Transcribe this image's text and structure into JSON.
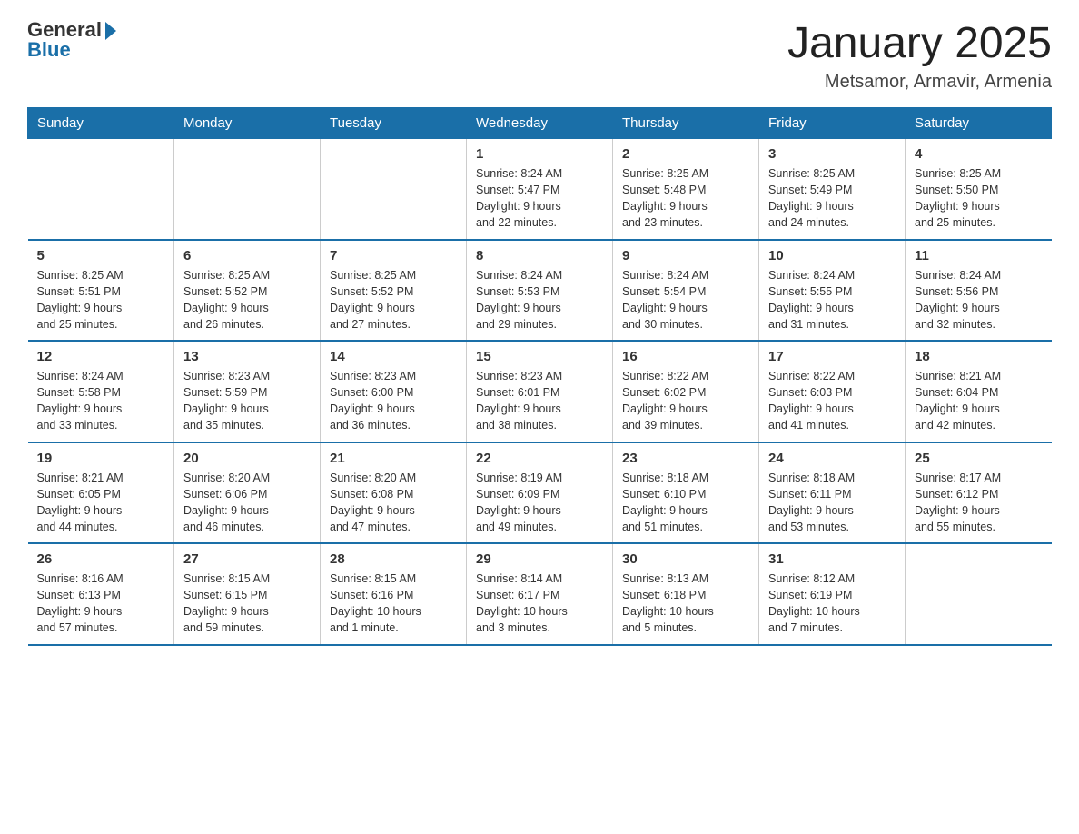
{
  "header": {
    "logo_general": "General",
    "logo_blue": "Blue",
    "title": "January 2025",
    "subtitle": "Metsamor, Armavir, Armenia"
  },
  "weekdays": [
    "Sunday",
    "Monday",
    "Tuesday",
    "Wednesday",
    "Thursday",
    "Friday",
    "Saturday"
  ],
  "weeks": [
    [
      {
        "day": "",
        "info": ""
      },
      {
        "day": "",
        "info": ""
      },
      {
        "day": "",
        "info": ""
      },
      {
        "day": "1",
        "info": "Sunrise: 8:24 AM\nSunset: 5:47 PM\nDaylight: 9 hours\nand 22 minutes."
      },
      {
        "day": "2",
        "info": "Sunrise: 8:25 AM\nSunset: 5:48 PM\nDaylight: 9 hours\nand 23 minutes."
      },
      {
        "day": "3",
        "info": "Sunrise: 8:25 AM\nSunset: 5:49 PM\nDaylight: 9 hours\nand 24 minutes."
      },
      {
        "day": "4",
        "info": "Sunrise: 8:25 AM\nSunset: 5:50 PM\nDaylight: 9 hours\nand 25 minutes."
      }
    ],
    [
      {
        "day": "5",
        "info": "Sunrise: 8:25 AM\nSunset: 5:51 PM\nDaylight: 9 hours\nand 25 minutes."
      },
      {
        "day": "6",
        "info": "Sunrise: 8:25 AM\nSunset: 5:52 PM\nDaylight: 9 hours\nand 26 minutes."
      },
      {
        "day": "7",
        "info": "Sunrise: 8:25 AM\nSunset: 5:52 PM\nDaylight: 9 hours\nand 27 minutes."
      },
      {
        "day": "8",
        "info": "Sunrise: 8:24 AM\nSunset: 5:53 PM\nDaylight: 9 hours\nand 29 minutes."
      },
      {
        "day": "9",
        "info": "Sunrise: 8:24 AM\nSunset: 5:54 PM\nDaylight: 9 hours\nand 30 minutes."
      },
      {
        "day": "10",
        "info": "Sunrise: 8:24 AM\nSunset: 5:55 PM\nDaylight: 9 hours\nand 31 minutes."
      },
      {
        "day": "11",
        "info": "Sunrise: 8:24 AM\nSunset: 5:56 PM\nDaylight: 9 hours\nand 32 minutes."
      }
    ],
    [
      {
        "day": "12",
        "info": "Sunrise: 8:24 AM\nSunset: 5:58 PM\nDaylight: 9 hours\nand 33 minutes."
      },
      {
        "day": "13",
        "info": "Sunrise: 8:23 AM\nSunset: 5:59 PM\nDaylight: 9 hours\nand 35 minutes."
      },
      {
        "day": "14",
        "info": "Sunrise: 8:23 AM\nSunset: 6:00 PM\nDaylight: 9 hours\nand 36 minutes."
      },
      {
        "day": "15",
        "info": "Sunrise: 8:23 AM\nSunset: 6:01 PM\nDaylight: 9 hours\nand 38 minutes."
      },
      {
        "day": "16",
        "info": "Sunrise: 8:22 AM\nSunset: 6:02 PM\nDaylight: 9 hours\nand 39 minutes."
      },
      {
        "day": "17",
        "info": "Sunrise: 8:22 AM\nSunset: 6:03 PM\nDaylight: 9 hours\nand 41 minutes."
      },
      {
        "day": "18",
        "info": "Sunrise: 8:21 AM\nSunset: 6:04 PM\nDaylight: 9 hours\nand 42 minutes."
      }
    ],
    [
      {
        "day": "19",
        "info": "Sunrise: 8:21 AM\nSunset: 6:05 PM\nDaylight: 9 hours\nand 44 minutes."
      },
      {
        "day": "20",
        "info": "Sunrise: 8:20 AM\nSunset: 6:06 PM\nDaylight: 9 hours\nand 46 minutes."
      },
      {
        "day": "21",
        "info": "Sunrise: 8:20 AM\nSunset: 6:08 PM\nDaylight: 9 hours\nand 47 minutes."
      },
      {
        "day": "22",
        "info": "Sunrise: 8:19 AM\nSunset: 6:09 PM\nDaylight: 9 hours\nand 49 minutes."
      },
      {
        "day": "23",
        "info": "Sunrise: 8:18 AM\nSunset: 6:10 PM\nDaylight: 9 hours\nand 51 minutes."
      },
      {
        "day": "24",
        "info": "Sunrise: 8:18 AM\nSunset: 6:11 PM\nDaylight: 9 hours\nand 53 minutes."
      },
      {
        "day": "25",
        "info": "Sunrise: 8:17 AM\nSunset: 6:12 PM\nDaylight: 9 hours\nand 55 minutes."
      }
    ],
    [
      {
        "day": "26",
        "info": "Sunrise: 8:16 AM\nSunset: 6:13 PM\nDaylight: 9 hours\nand 57 minutes."
      },
      {
        "day": "27",
        "info": "Sunrise: 8:15 AM\nSunset: 6:15 PM\nDaylight: 9 hours\nand 59 minutes."
      },
      {
        "day": "28",
        "info": "Sunrise: 8:15 AM\nSunset: 6:16 PM\nDaylight: 10 hours\nand 1 minute."
      },
      {
        "day": "29",
        "info": "Sunrise: 8:14 AM\nSunset: 6:17 PM\nDaylight: 10 hours\nand 3 minutes."
      },
      {
        "day": "30",
        "info": "Sunrise: 8:13 AM\nSunset: 6:18 PM\nDaylight: 10 hours\nand 5 minutes."
      },
      {
        "day": "31",
        "info": "Sunrise: 8:12 AM\nSunset: 6:19 PM\nDaylight: 10 hours\nand 7 minutes."
      },
      {
        "day": "",
        "info": ""
      }
    ]
  ]
}
